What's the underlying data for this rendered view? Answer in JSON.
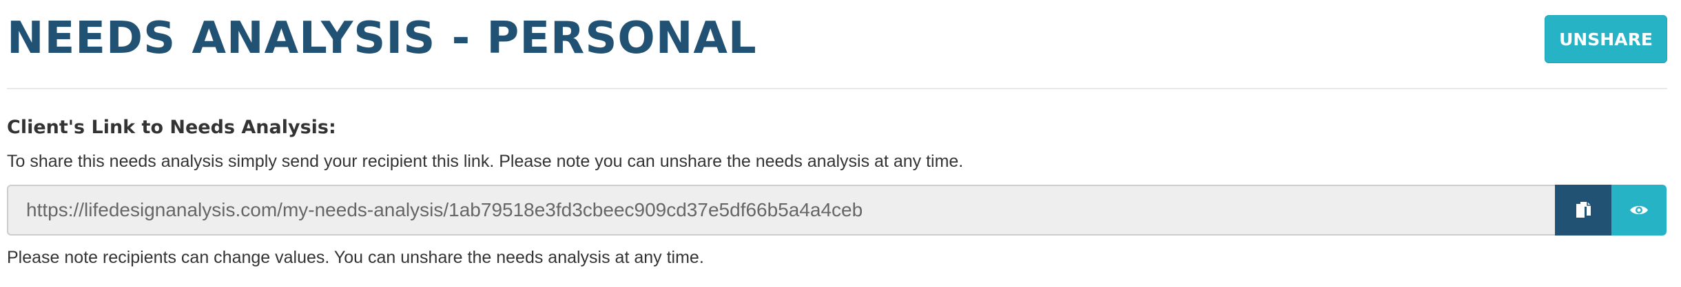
{
  "header": {
    "title": "NEEDS ANALYSIS - PERSONAL",
    "unshare_label": "UNSHARE"
  },
  "share": {
    "heading": "Client's Link to Needs Analysis:",
    "instructions": "To share this needs analysis simply send your recipient this link. Please note you can unshare the needs analysis at any time.",
    "link_value": "https://lifedesignanalysis.com/my-needs-analysis/1ab79518e3fd3cbeec909cd37e5df66b5a4a4ceb",
    "copy_icon": "copy-icon",
    "view_icon": "eye-icon",
    "note": "Please note recipients can change values. You can unshare the needs analysis at any time."
  },
  "colors": {
    "title": "#215273",
    "accent": "#27b3c6",
    "copy_button": "#215273",
    "input_background": "#eeeeee"
  }
}
